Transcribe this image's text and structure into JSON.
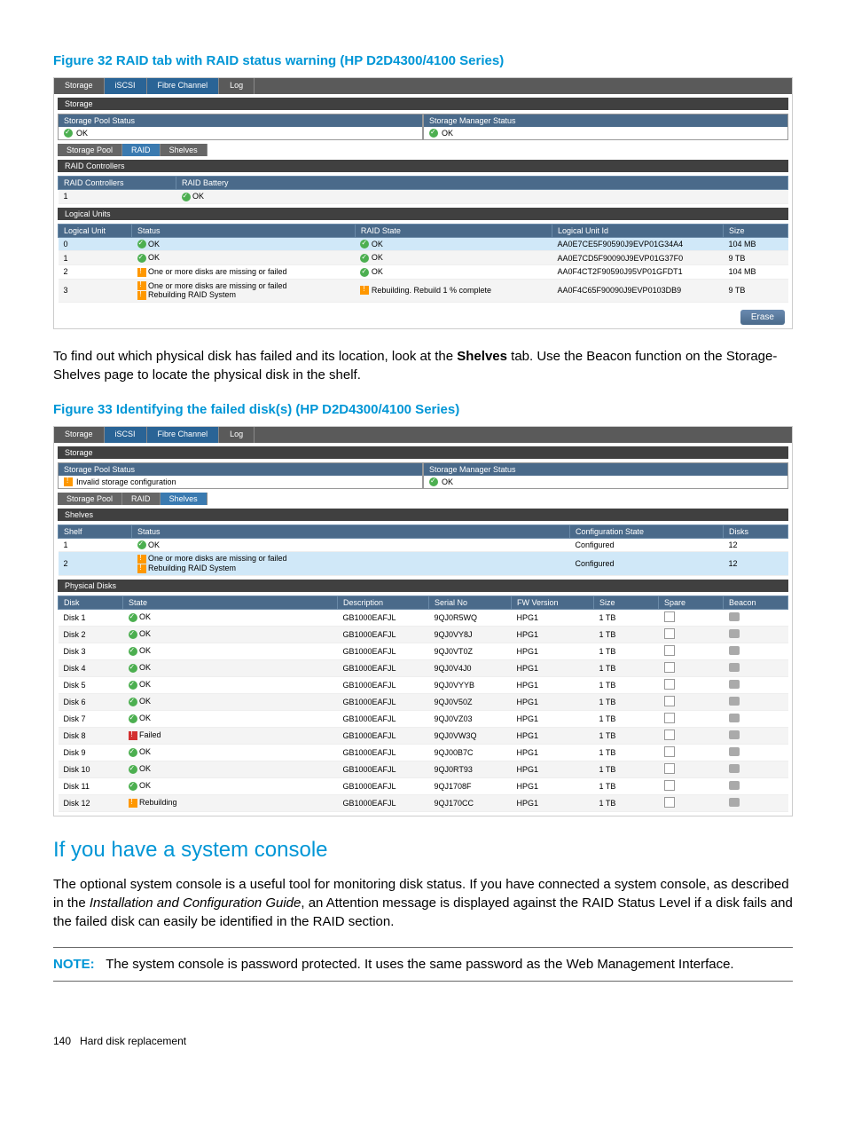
{
  "figure32": {
    "title": "Figure 32 RAID tab with RAID status warning (HP D2D4300/4100 Series)",
    "topTabs": [
      "Storage",
      "iSCSI",
      "Fibre Channel",
      "Log"
    ],
    "sectionLabel": "Storage",
    "poolStatusHeader": "Storage Pool Status",
    "poolStatusValue": "OK",
    "managerStatusHeader": "Storage Manager Status",
    "managerStatusValue": "OK",
    "subTabs": [
      "Storage Pool",
      "RAID",
      "Shelves"
    ],
    "raidControllersLabel": "RAID Controllers",
    "raidControllersHeaders": [
      "RAID Controllers",
      "RAID Battery"
    ],
    "raidControllersRow": {
      "id": "1",
      "battery": "OK"
    },
    "logicalUnitsLabel": "Logical Units",
    "logicalHeaders": [
      "Logical Unit",
      "Status",
      "RAID State",
      "Logical Unit Id",
      "Size"
    ],
    "logicalRows": [
      {
        "unit": "0",
        "status": "OK",
        "statusIcon": "ok",
        "raidState": "OK",
        "raidIcon": "ok",
        "id": "AA0E7CE5F90590J9EVP01G34A4",
        "size": "104 MB",
        "hl": true
      },
      {
        "unit": "1",
        "status": "OK",
        "statusIcon": "ok",
        "raidState": "OK",
        "raidIcon": "ok",
        "id": "AA0E7CD5F90090J9EVP01G37F0",
        "size": "9 TB"
      },
      {
        "unit": "2",
        "status": "One or more disks are missing or failed",
        "statusIcon": "warn",
        "raidState": "OK",
        "raidIcon": "ok",
        "id": "AA0F4CT2F90590J95VP01GFDT1",
        "size": "104 MB"
      },
      {
        "unit": "3",
        "status": "One or more disks are missing or failed",
        "status2": "Rebuilding RAID System",
        "statusIcon": "warn",
        "raidState": "Rebuilding. Rebuild 1 % complete",
        "raidIcon": "warn",
        "id": "AA0F4C65F90090J9EVP0103DB9",
        "size": "9 TB"
      }
    ],
    "eraseLabel": "Erase"
  },
  "bodyText1": "To find out which physical disk has failed and its location, look at the ",
  "bodyText1b": "Shelves",
  "bodyText1c": " tab. Use the Beacon function on the Storage-Shelves page to locate the physical disk in the shelf.",
  "figure33": {
    "title": "Figure 33 Identifying the failed disk(s) (HP D2D4300/4100 Series)",
    "topTabs": [
      "Storage",
      "iSCSI",
      "Fibre Channel",
      "Log"
    ],
    "sectionLabel": "Storage",
    "poolStatusHeader": "Storage Pool Status",
    "poolStatusValue": "Invalid storage configuration",
    "managerStatusHeader": "Storage Manager Status",
    "managerStatusValue": "OK",
    "subTabs": [
      "Storage Pool",
      "RAID",
      "Shelves"
    ],
    "shelvesLabel": "Shelves",
    "shelvesHeaders": [
      "Shelf",
      "Status",
      "Configuration State",
      "Disks"
    ],
    "shelvesRows": [
      {
        "shelf": "1",
        "status": "OK",
        "statusIcon": "ok",
        "cfg": "Configured",
        "disks": "12"
      },
      {
        "shelf": "2",
        "status": "One or more disks are missing or failed",
        "status2": "Rebuilding RAID System",
        "statusIcon": "warn",
        "cfg": "Configured",
        "disks": "12",
        "hl": true
      }
    ],
    "physicalDisksLabel": "Physical Disks",
    "diskHeaders": [
      "Disk",
      "State",
      "Description",
      "Serial No",
      "FW Version",
      "Size",
      "Spare",
      "Beacon"
    ],
    "diskRows": [
      {
        "disk": "Disk 1",
        "state": "OK",
        "icon": "ok",
        "desc": "GB1000EAFJL",
        "serial": "9QJ0R5WQ",
        "fw": "HPG1",
        "size": "1 TB"
      },
      {
        "disk": "Disk 2",
        "state": "OK",
        "icon": "ok",
        "desc": "GB1000EAFJL",
        "serial": "9QJ0VY8J",
        "fw": "HPG1",
        "size": "1 TB"
      },
      {
        "disk": "Disk 3",
        "state": "OK",
        "icon": "ok",
        "desc": "GB1000EAFJL",
        "serial": "9QJ0VT0Z",
        "fw": "HPG1",
        "size": "1 TB"
      },
      {
        "disk": "Disk 4",
        "state": "OK",
        "icon": "ok",
        "desc": "GB1000EAFJL",
        "serial": "9QJ0V4J0",
        "fw": "HPG1",
        "size": "1 TB"
      },
      {
        "disk": "Disk 5",
        "state": "OK",
        "icon": "ok",
        "desc": "GB1000EAFJL",
        "serial": "9QJ0VYYB",
        "fw": "HPG1",
        "size": "1 TB"
      },
      {
        "disk": "Disk 6",
        "state": "OK",
        "icon": "ok",
        "desc": "GB1000EAFJL",
        "serial": "9QJ0V50Z",
        "fw": "HPG1",
        "size": "1 TB"
      },
      {
        "disk": "Disk 7",
        "state": "OK",
        "icon": "ok",
        "desc": "GB1000EAFJL",
        "serial": "9QJ0VZ03",
        "fw": "HPG1",
        "size": "1 TB"
      },
      {
        "disk": "Disk 8",
        "state": "Failed",
        "icon": "fail",
        "desc": "GB1000EAFJL",
        "serial": "9QJ0VW3Q",
        "fw": "HPG1",
        "size": "1 TB"
      },
      {
        "disk": "Disk 9",
        "state": "OK",
        "icon": "ok",
        "desc": "GB1000EAFJL",
        "serial": "9QJ00B7C",
        "fw": "HPG1",
        "size": "1 TB"
      },
      {
        "disk": "Disk 10",
        "state": "OK",
        "icon": "ok",
        "desc": "GB1000EAFJL",
        "serial": "9QJ0RT93",
        "fw": "HPG1",
        "size": "1 TB"
      },
      {
        "disk": "Disk 11",
        "state": "OK",
        "icon": "ok",
        "desc": "GB1000EAFJL",
        "serial": "9QJ1708F",
        "fw": "HPG1",
        "size": "1 TB"
      },
      {
        "disk": "Disk 12",
        "state": "Rebuilding",
        "icon": "warn",
        "desc": "GB1000EAFJL",
        "serial": "9QJ170CC",
        "fw": "HPG1",
        "size": "1 TB"
      }
    ]
  },
  "heading": "If you have a system console",
  "bodyText2": "The optional system console is a useful tool for monitoring disk status. If you have connected a system console, as described in the ",
  "bodyText2i": "Installation and Configuration Guide",
  "bodyText2c": ", an Attention message is displayed against the RAID Status Level if a disk fails and the failed disk can easily be identified in the RAID section.",
  "noteLabel": "NOTE:",
  "noteText": "The system console is password protected. It uses the same password as the Web Management Interface.",
  "pageNum": "140",
  "pageSection": "Hard disk replacement"
}
